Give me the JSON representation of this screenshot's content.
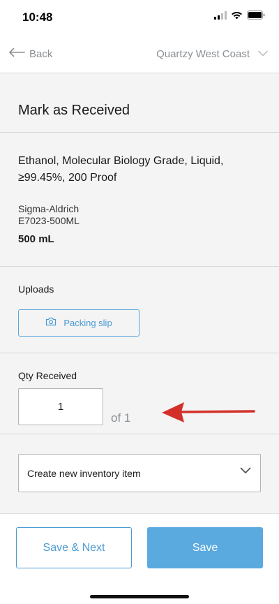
{
  "status_bar": {
    "time": "10:48",
    "icons": [
      "cellular-signal-icon",
      "wifi-icon",
      "battery-icon"
    ]
  },
  "nav": {
    "back_label": "Back",
    "back_icon": "arrow-left-icon",
    "org_label": "Quartzy West Coast",
    "org_icon": "chevron-down-icon"
  },
  "page": {
    "title": "Mark as Received"
  },
  "product": {
    "name": "Ethanol, Molecular Biology Grade, Liquid, ≥99.45%, 200 Proof",
    "vendor": "Sigma-Aldrich",
    "catalog_number": "E7023-500ML",
    "size": "500 mL"
  },
  "uploads": {
    "label": "Uploads",
    "packing_slip_label": "Packing slip",
    "packing_slip_icon": "camera-icon"
  },
  "quantity": {
    "label": "Qty Received",
    "value": "1",
    "of_label": "of 1"
  },
  "inventory": {
    "selected": "Create new inventory item",
    "icon": "chevron-down-icon"
  },
  "footer": {
    "save_next_label": "Save & Next",
    "save_label": "Save"
  },
  "colors": {
    "accent": "#4a9ad6",
    "primary_button": "#5aaae0",
    "annotation_arrow": "#d3302a",
    "background": "#f4f4f4"
  }
}
